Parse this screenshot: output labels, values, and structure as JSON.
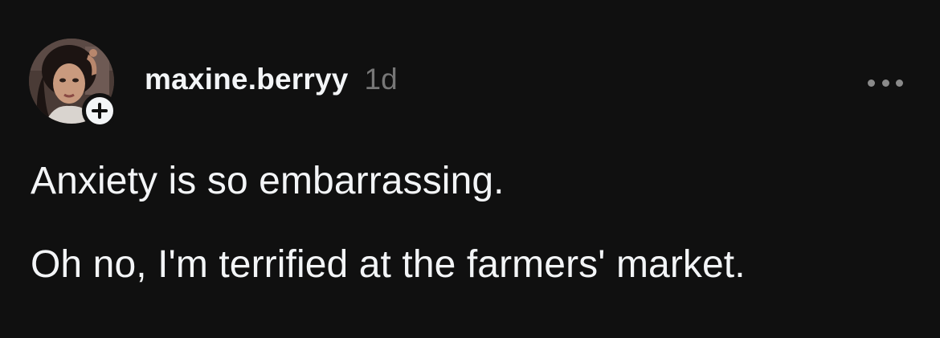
{
  "post": {
    "author": {
      "username": "maxine.berryy",
      "avatar_icon": "profile-photo",
      "follow_icon": "plus-icon"
    },
    "timestamp": "1d",
    "more_icon": "ellipsis-icon",
    "text_lines": [
      "Anxiety is so embarrassing.",
      "Oh no, I'm terrified at the farmers' market."
    ]
  },
  "colors": {
    "background": "#101010",
    "primary_text": "#f3f5f7",
    "secondary_text": "#777777"
  }
}
